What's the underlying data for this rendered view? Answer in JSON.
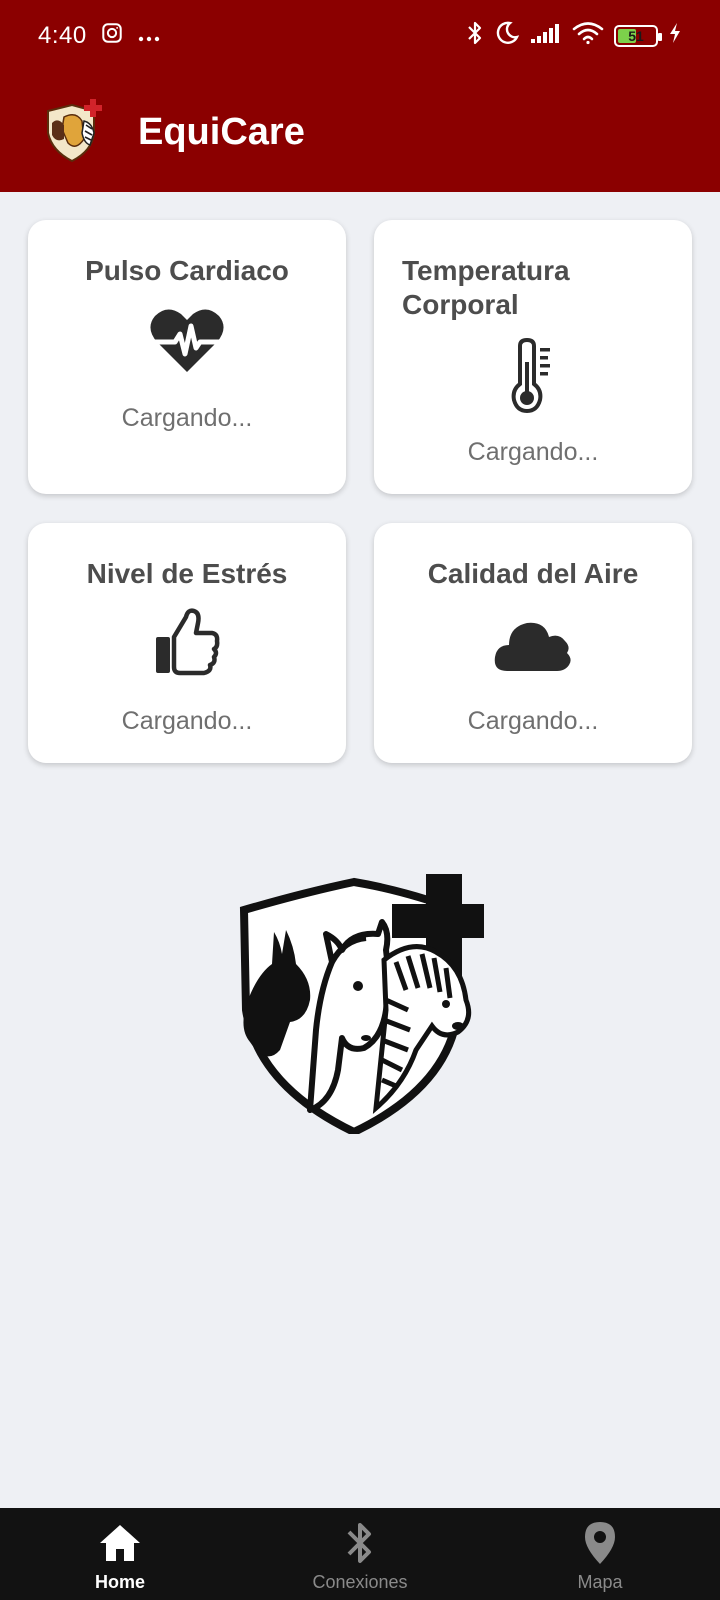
{
  "status_bar": {
    "time": "4:40",
    "battery": "51",
    "battery_level": 0.51,
    "icons": [
      "instagram-icon",
      "more-dots-icon",
      "bluetooth-icon",
      "moon-icon",
      "signal-icon",
      "wifi-icon",
      "battery-icon",
      "charging-icon"
    ]
  },
  "app_bar": {
    "title": "EquiCare",
    "logo": "equicare-logo"
  },
  "cards": [
    {
      "title": "Pulso Cardiaco",
      "value": "Cargando...",
      "icon": "heart-pulse-icon"
    },
    {
      "title": "Temperatura Corporal",
      "value": "Cargando...",
      "icon": "thermometer-icon"
    },
    {
      "title": "Nivel de Estrés",
      "value": "Cargando...",
      "icon": "thumbs-up-icon"
    },
    {
      "title": "Calidad del Aire",
      "value": "Cargando...",
      "icon": "cloud-icon"
    }
  ],
  "emblem": "equicare-emblem",
  "bottom_nav": {
    "items": [
      {
        "label": "Home",
        "icon": "home-icon",
        "active": true
      },
      {
        "label": "Conexiones",
        "icon": "bluetooth-icon",
        "active": false
      },
      {
        "label": "Mapa",
        "icon": "location-pin-icon",
        "active": false
      }
    ]
  },
  "colors": {
    "primary": "#8b0000",
    "background": "#eef0f4",
    "card": "#ffffff",
    "nav_background": "#121212",
    "nav_active": "#ffffff",
    "nav_inactive": "#8a8a8a"
  }
}
